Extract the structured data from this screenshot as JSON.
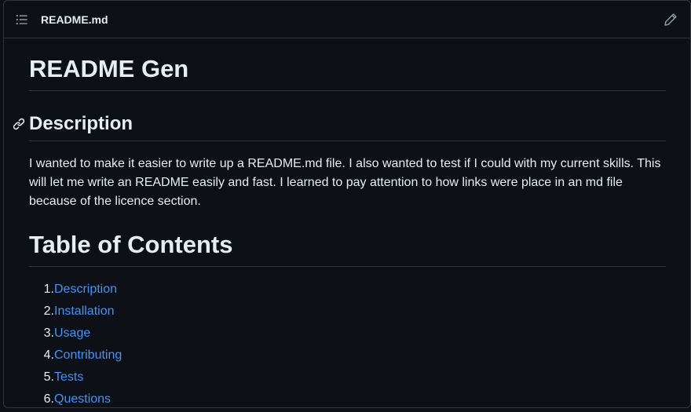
{
  "file": {
    "name": "README.md",
    "toc_icon": "list-unordered-icon",
    "edit_icon": "pencil-icon"
  },
  "readme": {
    "title": "README Gen",
    "description_heading": "Description",
    "description_text": "I wanted to make it easier to write up a README.md file. I also wanted to test if I could with my current skills. This will let me write an README easily and fast. I learned to pay attention to how links were place in an md file because of the licence section.",
    "toc_heading": "Table of Contents",
    "toc_items": [
      {
        "num": "1.",
        "label": "Description"
      },
      {
        "num": "2.",
        "label": "Installation"
      },
      {
        "num": "3.",
        "label": "Usage"
      },
      {
        "num": "4.",
        "label": "Contributing"
      },
      {
        "num": "5.",
        "label": "Tests"
      },
      {
        "num": "6.",
        "label": "Questions"
      }
    ]
  },
  "colors": {
    "background": "#0d1117",
    "border": "#30363d",
    "text": "#e6edf3",
    "link": "#4493f8"
  }
}
